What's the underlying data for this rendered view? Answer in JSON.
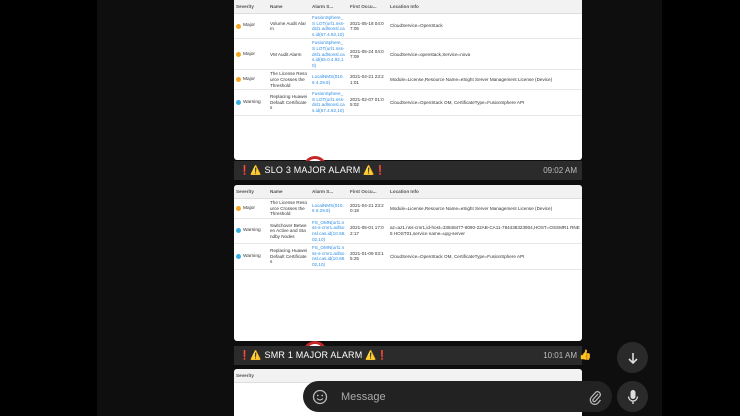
{
  "table_headers": [
    "Severity",
    "Name",
    "Alarm S...",
    "First Occu...",
    "Location Info"
  ],
  "shot_1": {
    "rows": [
      {
        "severity": "Major",
        "severity_color": "#f5a623",
        "name": "Volume Audit Alarm",
        "alarm_source": "FusionSphere_S LOT(url1.nss-dsl1.adlsonsl.cas.id(67.4.92,10)",
        "first_occurred": "2021-05-18 04:07:05",
        "location": "CloudService=OpenStack"
      },
      {
        "severity": "Major",
        "severity_color": "#f5a623",
        "name": "VM Audit Alarm",
        "alarm_source": "FusionSphere_S LOT(url1.nss-dsl1.adlsonsl.cas.id(65.0.4.92,10)",
        "first_occurred": "2021-05-24 04:07:09",
        "location": "CloudService=openstack,Service=nova"
      },
      {
        "severity": "Major",
        "severity_color": "#f5a623",
        "name": "The License Resource Crosses the Threshold",
        "alarm_source": "LocalNMS(010.6 4.29.8)",
        "first_occurred": "2021-04-21 23:21:01",
        "location": "Module=License,Resource Name=eSight Server Management License (Device)"
      },
      {
        "severity": "Warning",
        "severity_color": "#3ab0e2",
        "name": "Replacing Huawei Default Certificates",
        "alarm_source": "FusionSphere_S LOT(url1.nss-dsl1.adlsonsl.cas.id(67.4.92,10)",
        "first_occurred": "2021-02-07 01:05:02",
        "location": "CloudService=OpenStack OM, CertificateType=FusionSphere API"
      }
    ]
  },
  "caption_1": {
    "text": "❗⚠️ SLO 3 MAJOR ALARM ⚠️❗",
    "time": "09:02 AM"
  },
  "shot_2": {
    "rows": [
      {
        "severity": "Major",
        "severity_color": "#f5a623",
        "name": "The License Resource Crosses the Threshold",
        "alarm_source": "LocalNMS(010.6 6.29.8)",
        "first_occurred": "2021-04-21 23:20:18",
        "location": "Module=License,Resource Name=eSight Server Management License (Device)"
      },
      {
        "severity": "Warning",
        "severity_color": "#3ab0e2",
        "name": "Switchover Between Active and Standby Nodes",
        "alarm_source": "FS_OMN(url1.nss-s-cmr1.adlsonsl.cas.id(10.68.02,10)",
        "first_occurred": "2021-05-01 17:02:17",
        "location": "az=az1.nss-cmr1,id-host=33848477-8090-22AB-CA11-784438323904,HOST=OSSMR1 RNE5 HOST01,service name=upg-server"
      },
      {
        "severity": "Warning",
        "severity_color": "#3ab0e2",
        "name": "Replacing Huawei Default Certificates",
        "alarm_source": "FS_OMN(url1.nss-s-cmr1.adlsonsl.cas.id(10.68.02,10)",
        "first_occurred": "2021-01-09 03:15:25",
        "location": "CloudService=OpenStack OM, CertificateType=FusionSphere API"
      }
    ]
  },
  "caption_2": {
    "text": "❗⚠️ SMR 1 MAJOR ALARM ⚠️❗",
    "time": "10:01 AM"
  },
  "reaction": "👍",
  "shot_3": {
    "header_first": "Severity"
  },
  "composer": {
    "placeholder": "Message"
  },
  "icons": {
    "avatar": "red-alarm-siren-icon",
    "scroll": "arrow-down-icon",
    "emoji": "smiley-face-icon",
    "attach": "paperclip-icon",
    "mic": "microphone-icon"
  }
}
